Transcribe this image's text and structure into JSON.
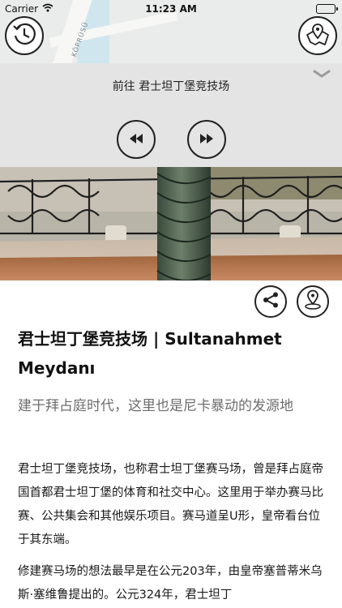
{
  "status_bar": {
    "carrier": "Carrier",
    "time": "11:23 AM"
  },
  "map": {
    "road_label": "KÖPRÜSÜ"
  },
  "player": {
    "now_playing": "前往 君士坦丁堡竞技场"
  },
  "icons": {
    "history": "clock-icon",
    "map": "map-pins-icon",
    "collapse": "chevron-down-icon",
    "rewind": "rewind-icon",
    "forward": "fast-forward-icon",
    "share": "share-icon",
    "location": "location-pin-icon"
  },
  "article": {
    "title": "君士坦丁堡竞技场 | Sultanahmet Meydanı",
    "subtitle": "建于拜占庭时代，这里也是尼卡暴动的发源地",
    "paragraphs": [
      "君士坦丁堡竞技场，也称君士坦丁堡赛马场，曾是拜占庭帝国首都君士坦丁堡的体育和社交中心。这里用于举办赛马比赛、公共集会和其他娱乐项目。赛马道呈U形，皇帝看台位于其东端。",
      "修建赛马场的想法最早是在公元203年，由皇帝塞普蒂米乌斯·塞维鲁提出的。公元324年，君士坦丁"
    ]
  }
}
